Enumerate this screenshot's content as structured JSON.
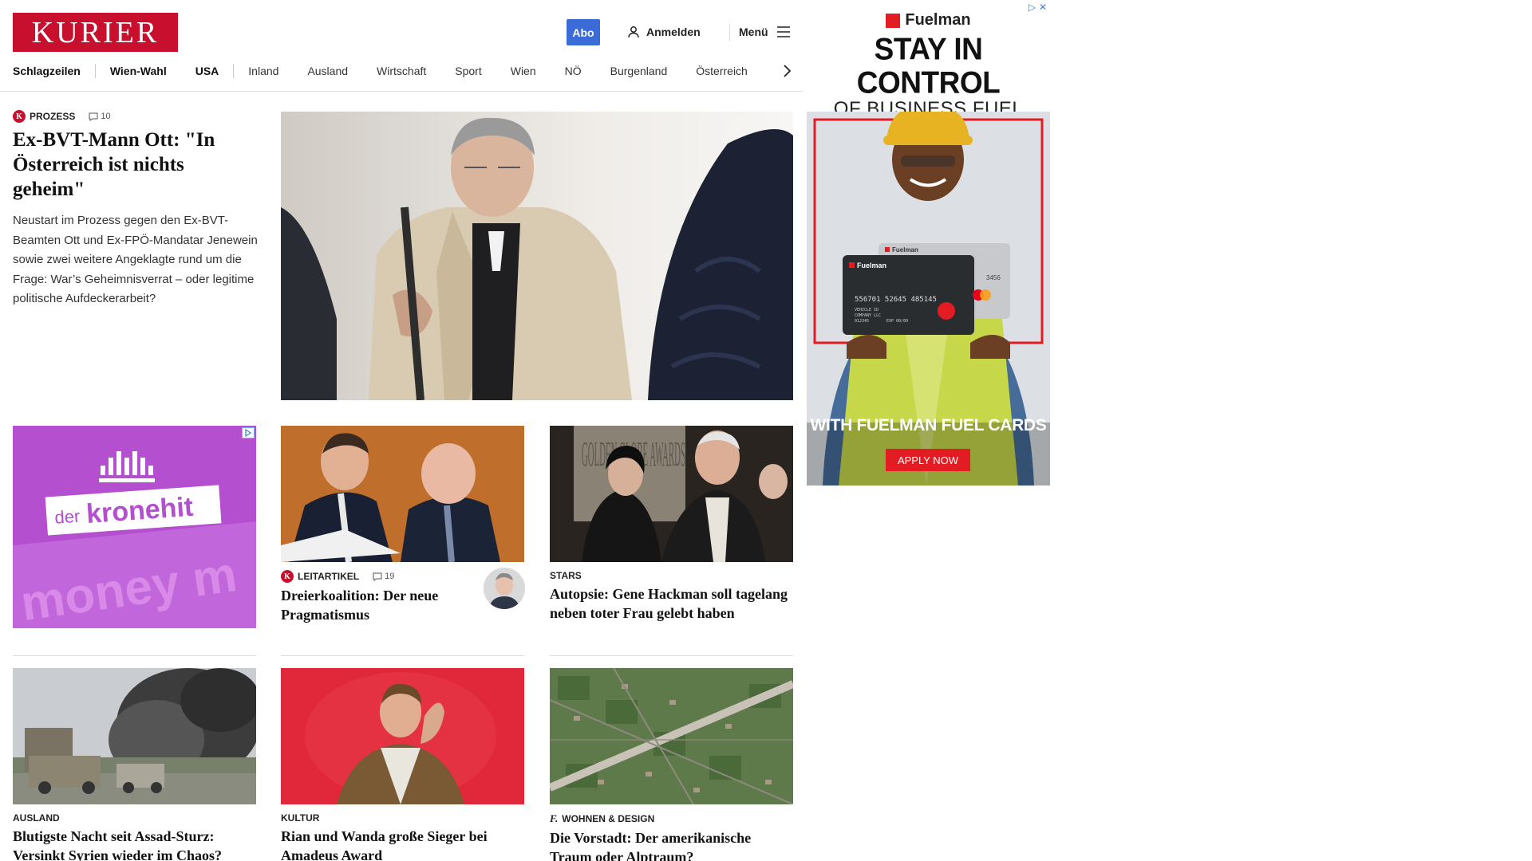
{
  "header": {
    "logo": "KURIER",
    "abo": "Abo",
    "login": "Anmelden",
    "menu": "Menü"
  },
  "nav": [
    "Schlagzeilen",
    "Wien-Wahl",
    "USA",
    "Inland",
    "Ausland",
    "Wirtschaft",
    "Sport",
    "Wien",
    "NÖ",
    "Burgenland",
    "Österreich"
  ],
  "lead": {
    "kicker": "PROZESS",
    "comments": "10",
    "title": "Ex-BVT-Mann Ott: \"In Österreich ist nichts geheim\"",
    "teaser": "Neustart im Prozess gegen den Ex-BVT-Beamten Ott und Ex-FPÖ-Mandatar Jenewein sowie zwei weitere Angeklagte rund um die Frage: War’s Geheimnisverrat – oder legitime politische Aufdeckerarbeit?"
  },
  "ads": {
    "kronehit_brand_left": "der",
    "kronehit_brand_right": "kronehit",
    "kronehit_bg_text": "money m",
    "fuelman_brand": "Fuelman",
    "fuelman_headline": "STAY IN CONTROL",
    "fuelman_subline": "OF BUSINESS FUEL COSTS",
    "fuelman_card_brand": "Fuelman",
    "fuelman_card_brand_small": "Fuelman",
    "fuelman_card_number": "556701 52645 485145",
    "fuelman_card_last": "3456",
    "fuelman_card_line1": "VEHICLE ID",
    "fuelman_card_line2": "COMPANY LLC",
    "fuelman_card_line3": "012345",
    "fuelman_card_exp": "EXP 00/00",
    "fuelman_bottom": "WITH FUELMAN FUEL CARDS",
    "fuelman_cta": "APPLY NOW"
  },
  "cards": [
    {
      "kicker": "LEITARTIKEL",
      "comments": "19",
      "title": "Dreierkoalition: Der neue Pragmatismus"
    },
    {
      "kicker": "STARS",
      "title": "Autopsie: Gene Hackman soll tagelang neben toter Frau gelebt haben"
    },
    {
      "kicker": "AUSLAND",
      "title": "Blutigste Nacht seit Assad-Sturz: Versinkt Syrien wieder im Chaos?"
    },
    {
      "kicker": "KULTUR",
      "title": "Rian und Wanda große Sieger bei Amadeus Award"
    },
    {
      "kicker": "WOHNEN & DESIGN",
      "title": "Die Vorstadt: Der amerikanische Traum oder Alptraum?"
    }
  ],
  "image_texts": {
    "globe_sign": "GOLDEN GLOBE AWARDS"
  },
  "colors": {
    "brand_red": "#c8102e",
    "abo_blue": "#3a6bd6",
    "kronehit_purple": "#b44fcf",
    "fuelman_red": "#e31b23"
  }
}
